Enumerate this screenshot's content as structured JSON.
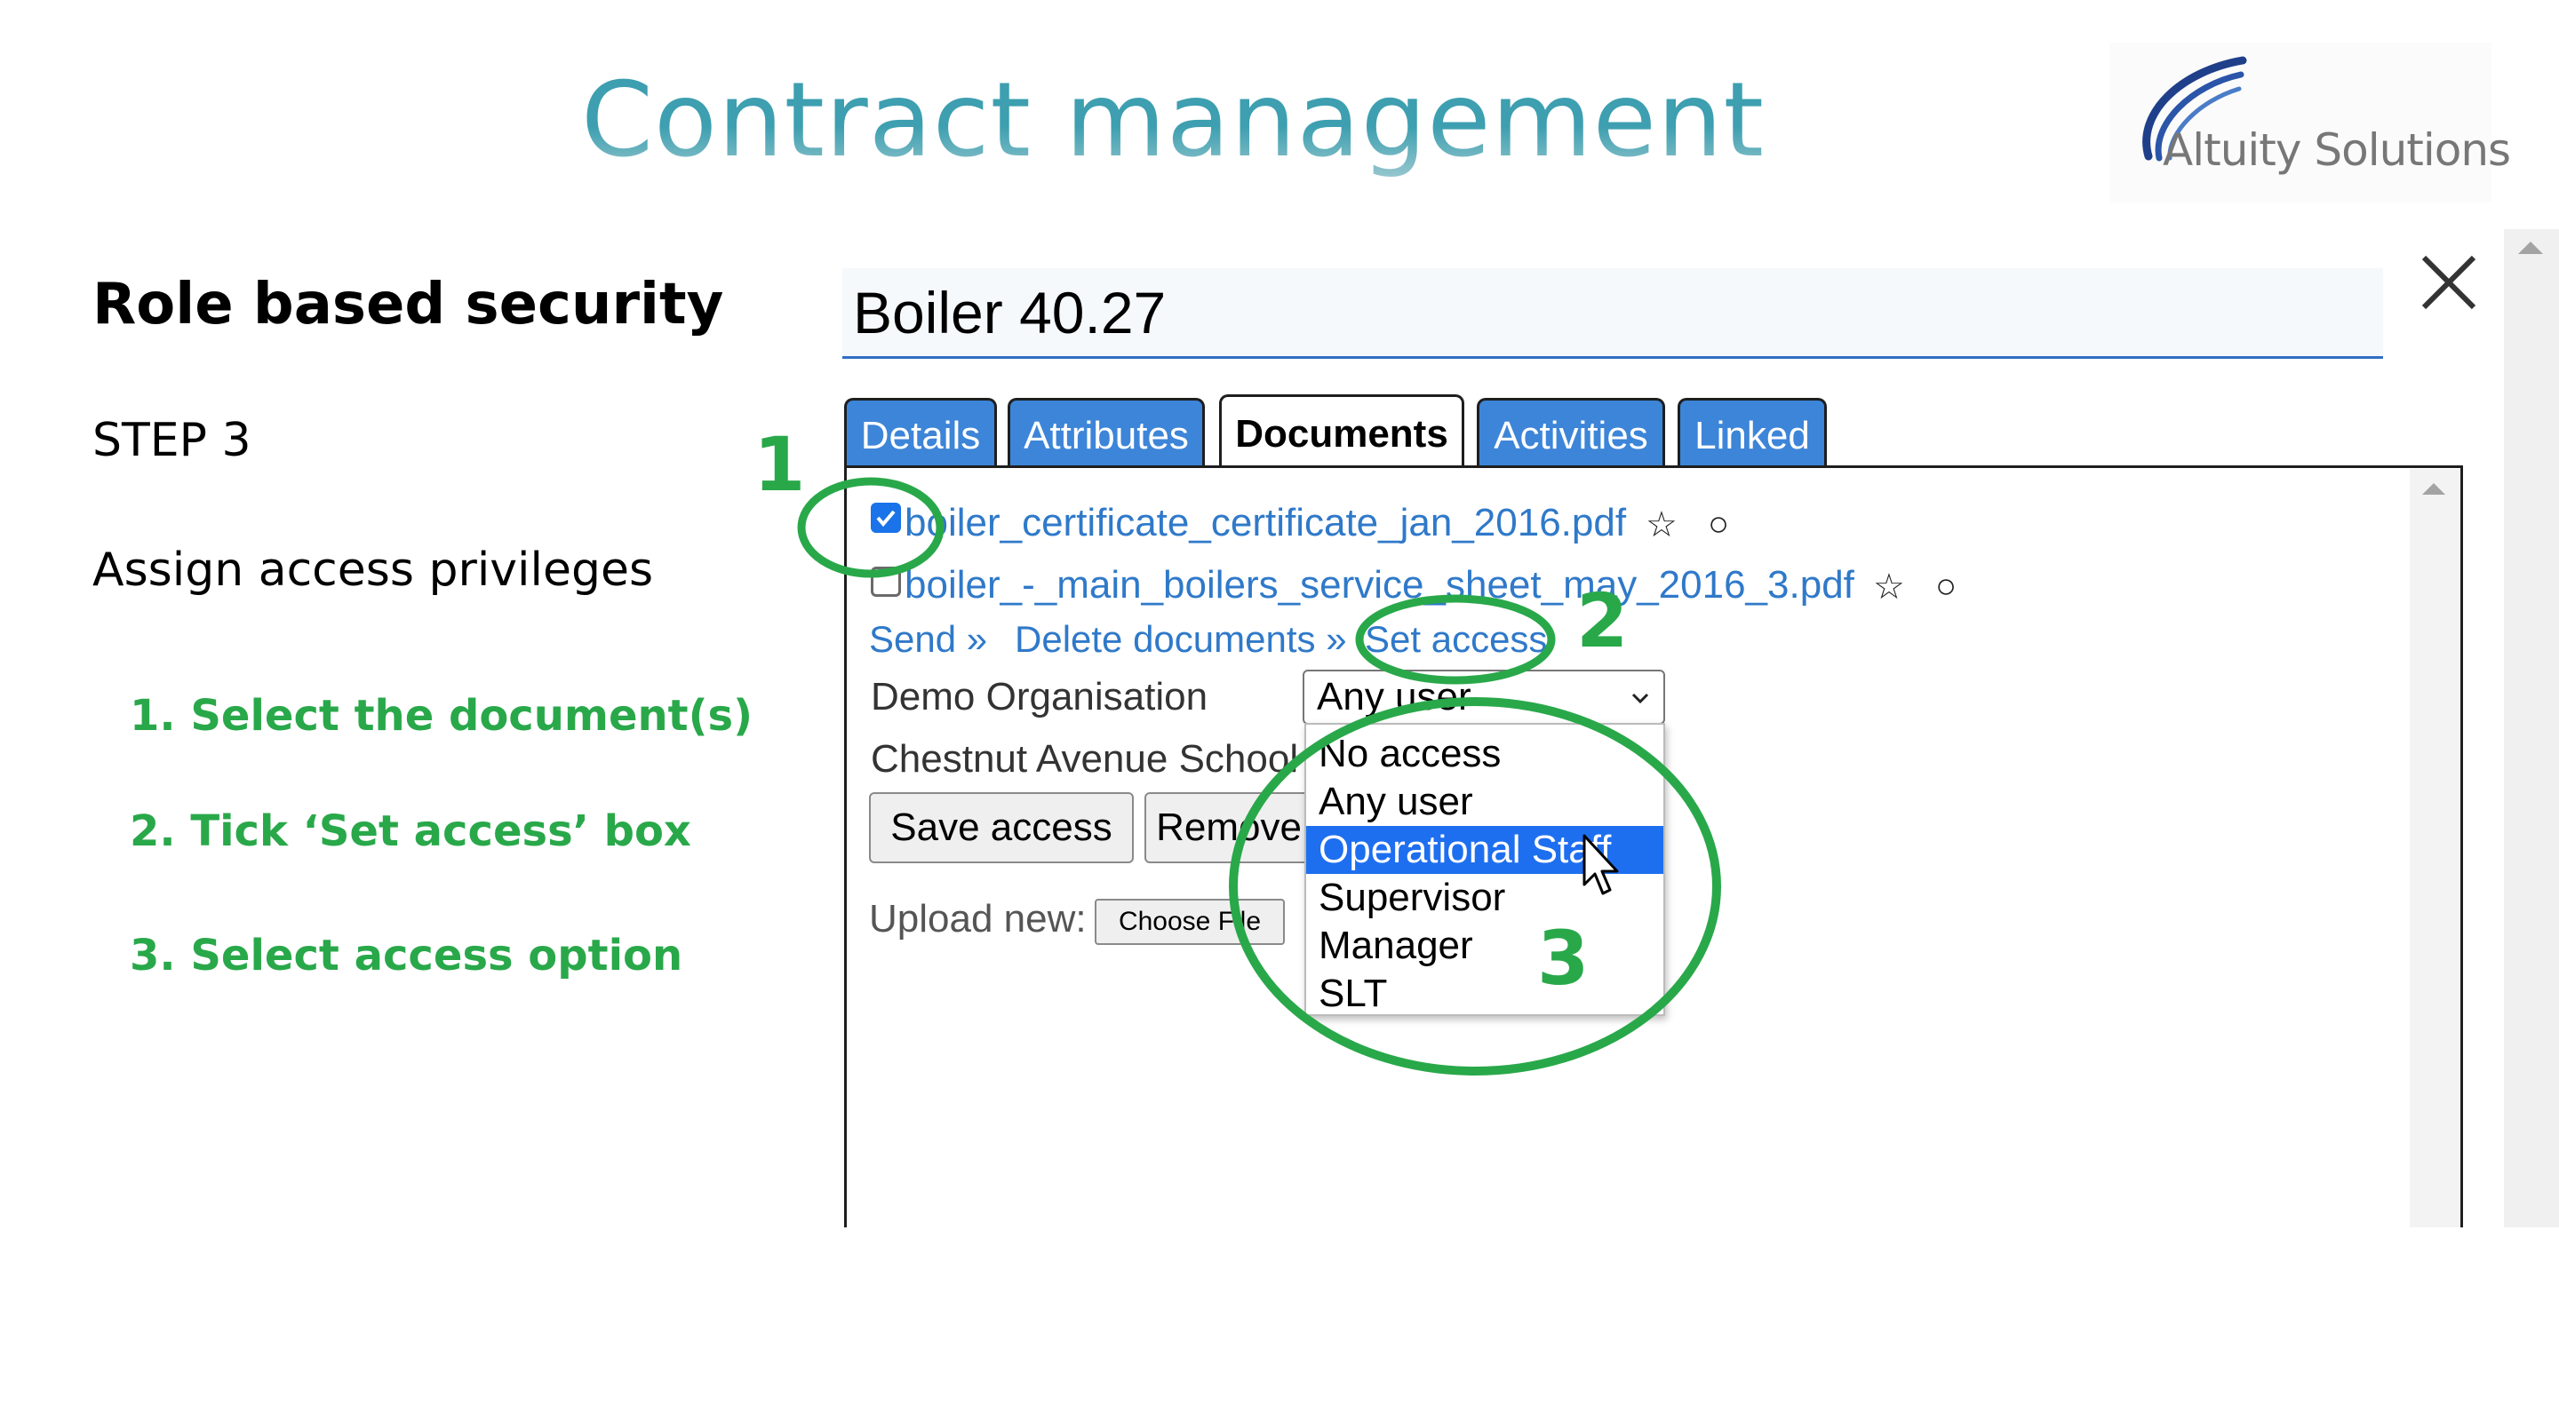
{
  "slide": {
    "title": "Contract management",
    "logo_text": "Altuity Solutions"
  },
  "left": {
    "heading": "Role based security",
    "step": "STEP 3",
    "subheading": "Assign access privileges",
    "instructions": [
      "1. Select the document(s)",
      "2. Tick ‘Set access’ box",
      "3. Select access option"
    ]
  },
  "panel": {
    "record_title": "Boiler 40.27",
    "tabs": [
      {
        "label": "Details",
        "active": false
      },
      {
        "label": "Attributes",
        "active": false
      },
      {
        "label": "Documents",
        "active": true
      },
      {
        "label": "Activities",
        "active": false
      },
      {
        "label": "Linked",
        "active": false
      }
    ],
    "documents": [
      {
        "name": "boiler_certificate_certificate_jan_2016.pdf",
        "checked": true,
        "star": "☆",
        "circle": "○"
      },
      {
        "name": "boiler_-_main_boilers_service_sheet_may_2016_3.pdf",
        "checked": false,
        "star": "☆",
        "circle": "○"
      }
    ],
    "actions": {
      "send": "Send »",
      "delete": "Delete documents »",
      "set_access": "Set access"
    },
    "orgs": [
      {
        "name": "Demo Organisation",
        "selected_value": "Any user"
      },
      {
        "name": "Chestnut Avenue School"
      }
    ],
    "buttons": {
      "save_access": "Save access",
      "remove": "Remove"
    },
    "upload": {
      "label": "Upload new:",
      "choose_file": "Choose File"
    },
    "dropdown_options": [
      {
        "label": "No access",
        "selected": false
      },
      {
        "label": "Any user",
        "selected": false
      },
      {
        "label": "Operational Staff",
        "selected": true
      },
      {
        "label": "Supervisor",
        "selected": false
      },
      {
        "label": "Manager",
        "selected": false
      },
      {
        "label": "SLT",
        "selected": false
      }
    ]
  },
  "annotations": {
    "one": "1",
    "two": "2",
    "three": "3"
  },
  "colors": {
    "annotation_green": "#29a84a",
    "tab_blue": "#3d85d8",
    "link_blue": "#2f79c9",
    "selected_blue": "#1e6ff0"
  }
}
